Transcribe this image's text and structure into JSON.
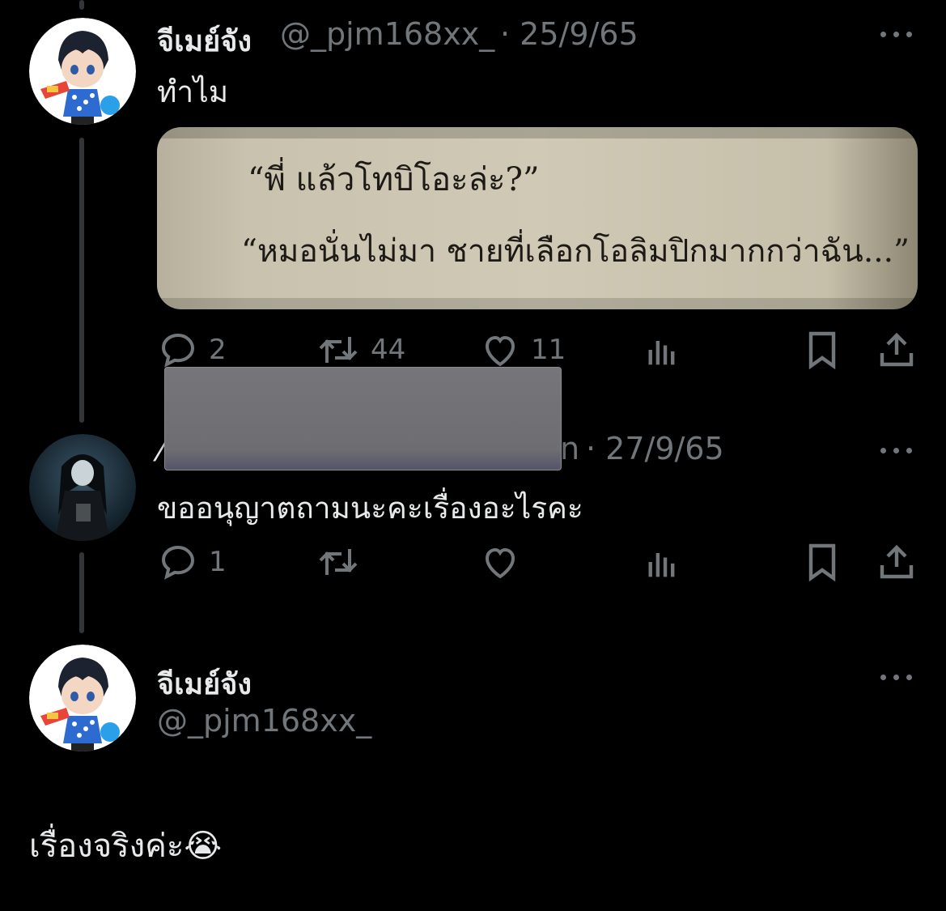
{
  "tweets": [
    {
      "display_name": "จีเมย์จัง",
      "handle": "@_pjm168xx_",
      "date": "· 25/9/65",
      "text": "ทำไม",
      "media_lines": [
        "“พี่ แล้วโทบิโอะล่ะ?”",
        "“หมอนั่นไม่มา ชายที่เลือกโอลิมปิกมากกว่าฉัน...”"
      ],
      "replies": "2",
      "retweets": "44",
      "likes": "11"
    },
    {
      "display_name_partial": "⁄",
      "handle_partial": "n",
      "date": "· 27/9/65",
      "text": "ขออนุญาตถามนะคะเรื่องอะไรคะ",
      "replies": "1",
      "retweets": "",
      "likes": ""
    },
    {
      "display_name": "จีเมย์จัง",
      "handle": "@_pjm168xx_",
      "text": "เรื่องจริงค่ะ😭"
    }
  ],
  "colors": {
    "background": "#000000",
    "primary_text": "#e7e9ea",
    "secondary_text": "#71767b",
    "thread_line": "#333639"
  },
  "icons": [
    "reply-icon",
    "retweet-icon",
    "like-icon",
    "views-icon",
    "bookmark-icon",
    "share-icon",
    "more-icon"
  ]
}
